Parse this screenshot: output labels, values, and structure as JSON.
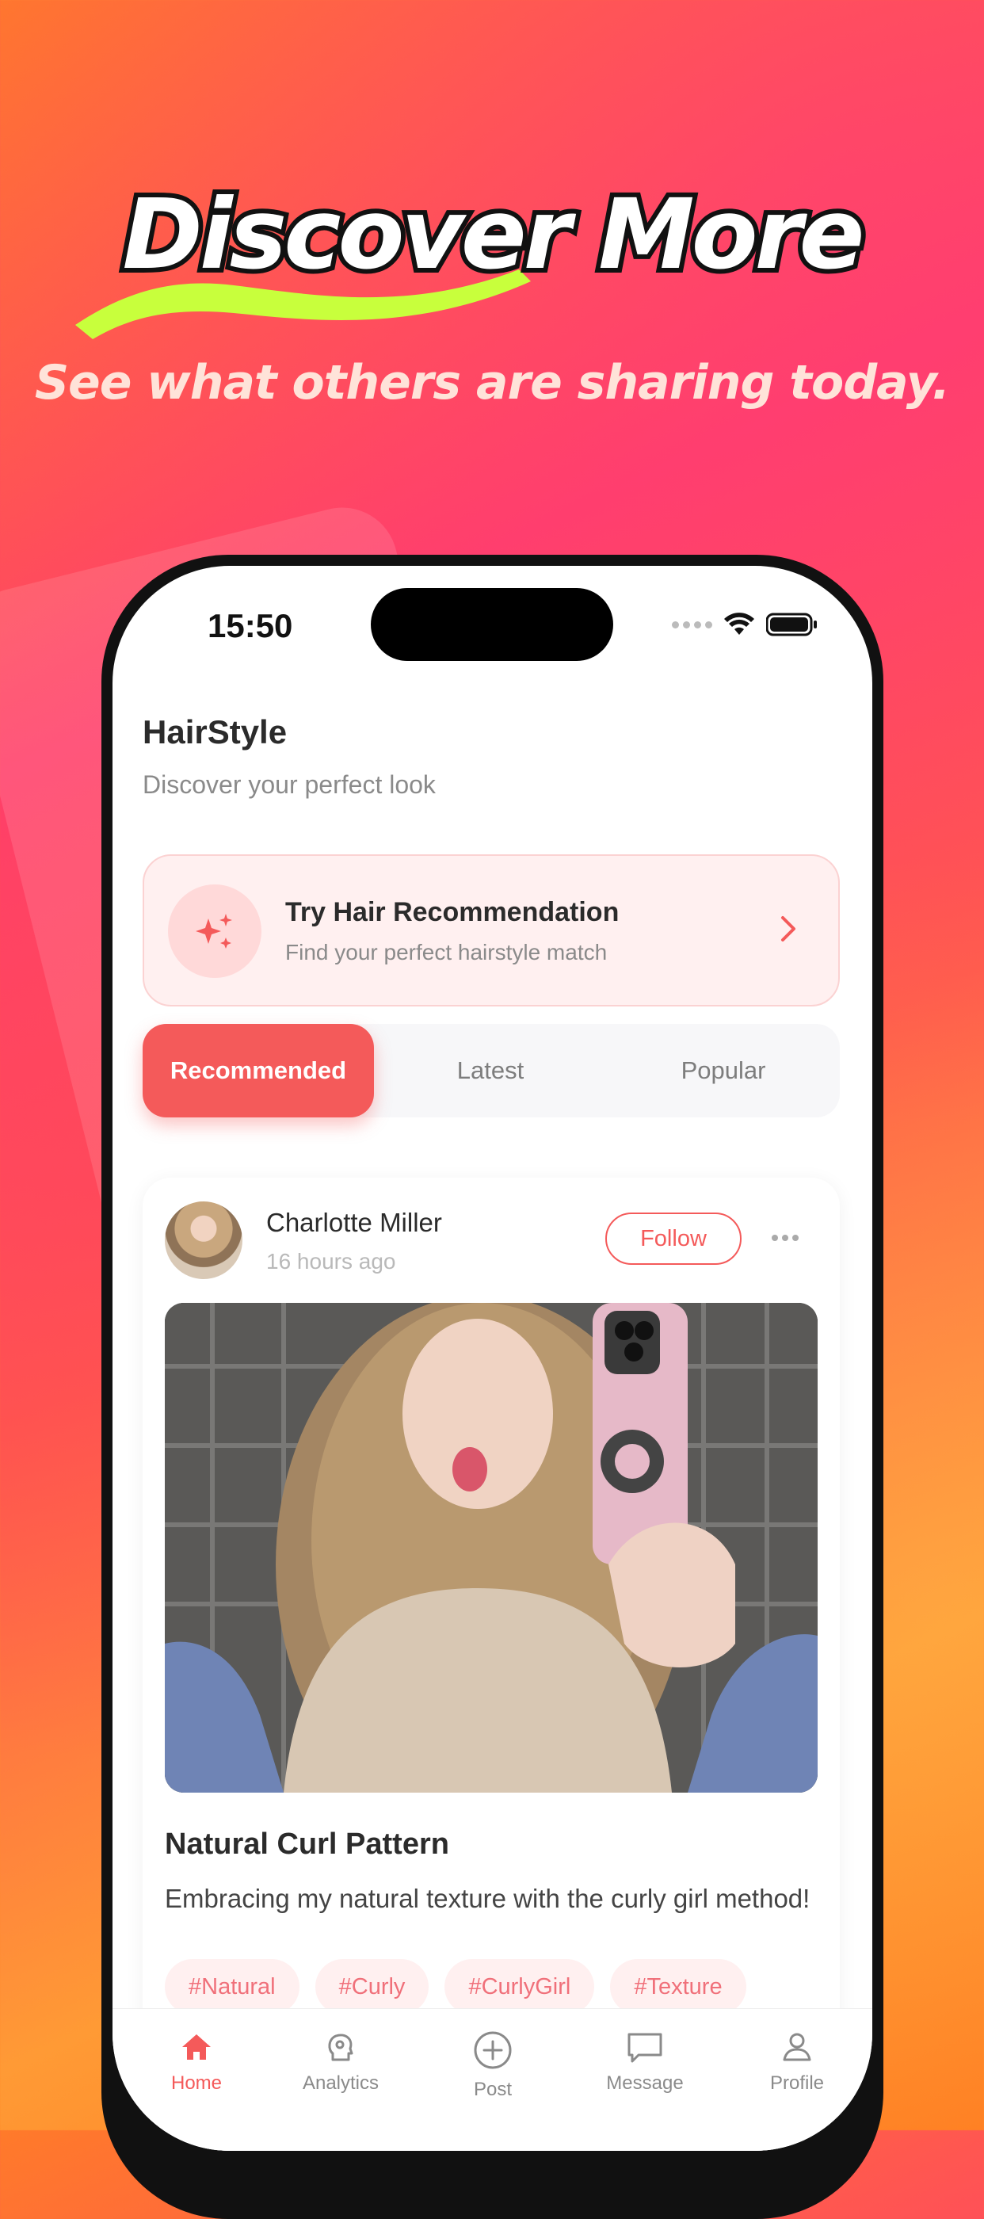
{
  "promo": {
    "headline": "Discover More",
    "subheadline": "See what others are sharing today."
  },
  "status_bar": {
    "time": "15:50"
  },
  "app": {
    "title": "HairStyle",
    "subtitle": "Discover your perfect look"
  },
  "recommendation_card": {
    "title": "Try Hair Recommendation",
    "subtitle": "Find your perfect hairstyle match"
  },
  "feed_tabs": [
    {
      "label": "Recommended",
      "active": true
    },
    {
      "label": "Latest",
      "active": false
    },
    {
      "label": "Popular",
      "active": false
    }
  ],
  "post": {
    "author": "Charlotte Miller",
    "time": "16 hours ago",
    "follow_label": "Follow",
    "title": "Natural Curl Pattern",
    "text": "Embracing my natural texture with the curly girl method!",
    "tags": [
      "#Natural",
      "#Curly",
      "#CurlyGirl",
      "#Texture"
    ]
  },
  "tab_bar": [
    {
      "label": "Home",
      "icon": "home-icon",
      "active": true
    },
    {
      "label": "Analytics",
      "icon": "analytics-icon",
      "active": false
    },
    {
      "label": "Post",
      "icon": "add-circle-icon",
      "active": false
    },
    {
      "label": "Message",
      "icon": "message-icon",
      "active": false
    },
    {
      "label": "Profile",
      "icon": "profile-icon",
      "active": false
    }
  ],
  "colors": {
    "accent": "#f45a5a",
    "accent_light": "#fff0f0",
    "swoosh": "#c8ff3c"
  }
}
